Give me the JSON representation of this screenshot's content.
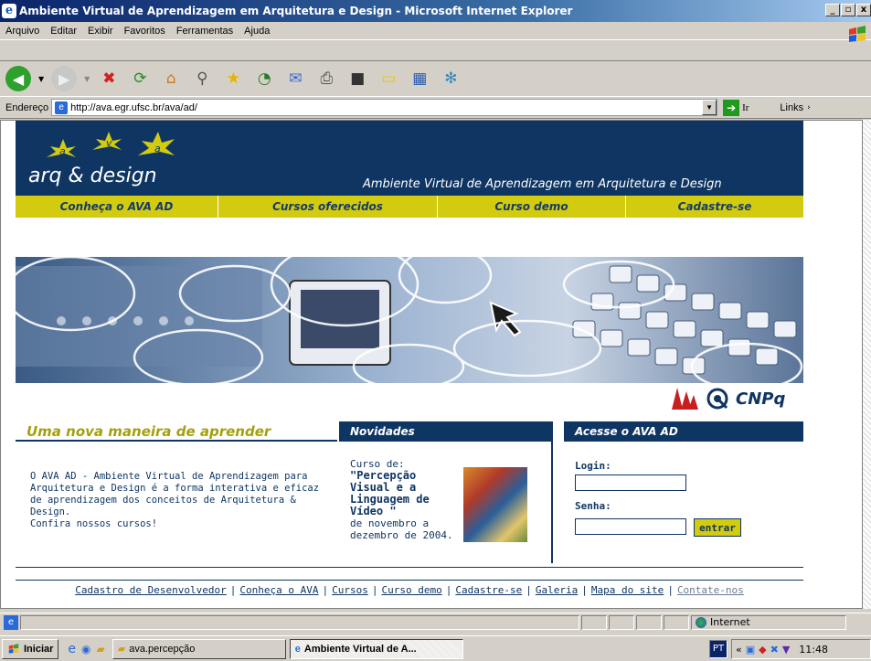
{
  "window": {
    "title": "Ambiente Virtual de Aprendizagem em Arquitetura e Design - Microsoft Internet Explorer"
  },
  "menu": [
    "Arquivo",
    "Editar",
    "Exibir",
    "Favoritos",
    "Ferramentas",
    "Ajuda"
  ],
  "address": {
    "label": "Endereço",
    "url": "http://ava.egr.ufsc.br/ava/ad/",
    "go_label": "Ir",
    "links_label": "Links"
  },
  "page": {
    "logo_text": "arq & design",
    "logo_letters": [
      "a",
      "v",
      "a"
    ],
    "site_title": "Ambiente Virtual de Aprendizagem em Arquitetura e Design",
    "nav": [
      "Conheça o AVA AD",
      "Cursos oferecidos",
      "Curso demo",
      "Cadastre-se"
    ],
    "sponsor": "CNPq",
    "intro": {
      "heading": "Uma nova maneira de aprender",
      "text": "O AVA AD - Ambiente Virtual de Aprendizagem para Arquitetura e Design é a forma interativa e eficaz de aprendizagem dos conceitos de Arquitetura & Design.",
      "cta": "Confira nossos cursos!"
    },
    "news": {
      "heading": "Novidades",
      "prefix": "Curso de:",
      "course": "\"Percepção Visual e a Linguagem de Vídeo \"",
      "dates": "de novembro a dezembro de 2004."
    },
    "login": {
      "heading": "Acesse o AVA AD",
      "login_label": "Login",
      "password_label": "Senha",
      "submit": "entrar"
    },
    "footer": [
      "Cadastro de Desenvolvedor",
      "Conheça o AVA",
      "Cursos",
      "Curso demo",
      "Cadastre-se",
      "Galeria",
      "Mapa do site",
      "Contate-nos"
    ]
  },
  "status": {
    "zone": "Internet"
  },
  "taskbar": {
    "start": "Iniciar",
    "tasks": [
      "ava.percepção",
      "Ambiente Virtual de A..."
    ],
    "lang": "PT",
    "clock": "11:48"
  }
}
